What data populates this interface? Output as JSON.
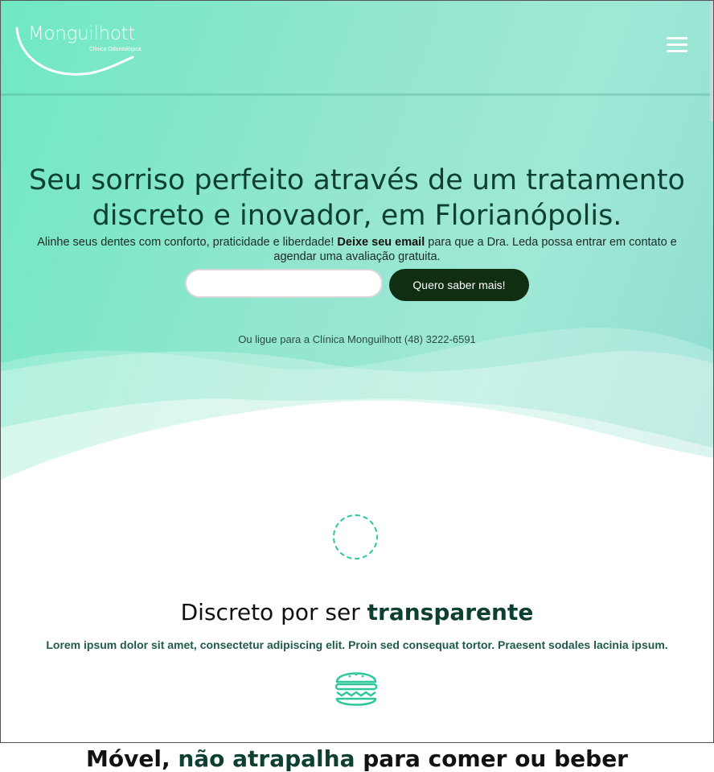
{
  "brand": {
    "name": "Monguilhott",
    "tagline": "Clínica Odontológica"
  },
  "menu": {
    "icon": "hamburger-menu-icon"
  },
  "hero": {
    "headline": "Seu sorriso perfeito através de um tratamento discreto e inovador, em Florianópolis.",
    "sub_before": "Alinhe seus dentes com conforto, praticidade e liberdade! ",
    "sub_bold": "Deixe seu email",
    "sub_after": " para que a Dra. Leda possa entrar em contato e agendar uma avaliação gratuita.",
    "email_placeholder": "",
    "cta_label": "Quero saber mais!",
    "phone_text": "Ou ligue para a Clínica Monguilhott (48) 3222-6591"
  },
  "features": [
    {
      "icon": "dashed-circle-icon",
      "title_plain": "Discreto por ser ",
      "title_bold": "transparente",
      "text": "Lorem ipsum dolor sit amet, consectetur adipiscing elit. Proin sed consequat tortor. Praesent sodales lacinia ipsum."
    },
    {
      "icon": "burger-icon",
      "title_plain_1": "Móvel, ",
      "title_bold": "não atrapalha",
      "title_plain_2": " para comer ou beber"
    }
  ],
  "colors": {
    "accent": "#2ec79b",
    "dark_green": "#0d3f33",
    "cta_bg": "#0f2e12"
  }
}
